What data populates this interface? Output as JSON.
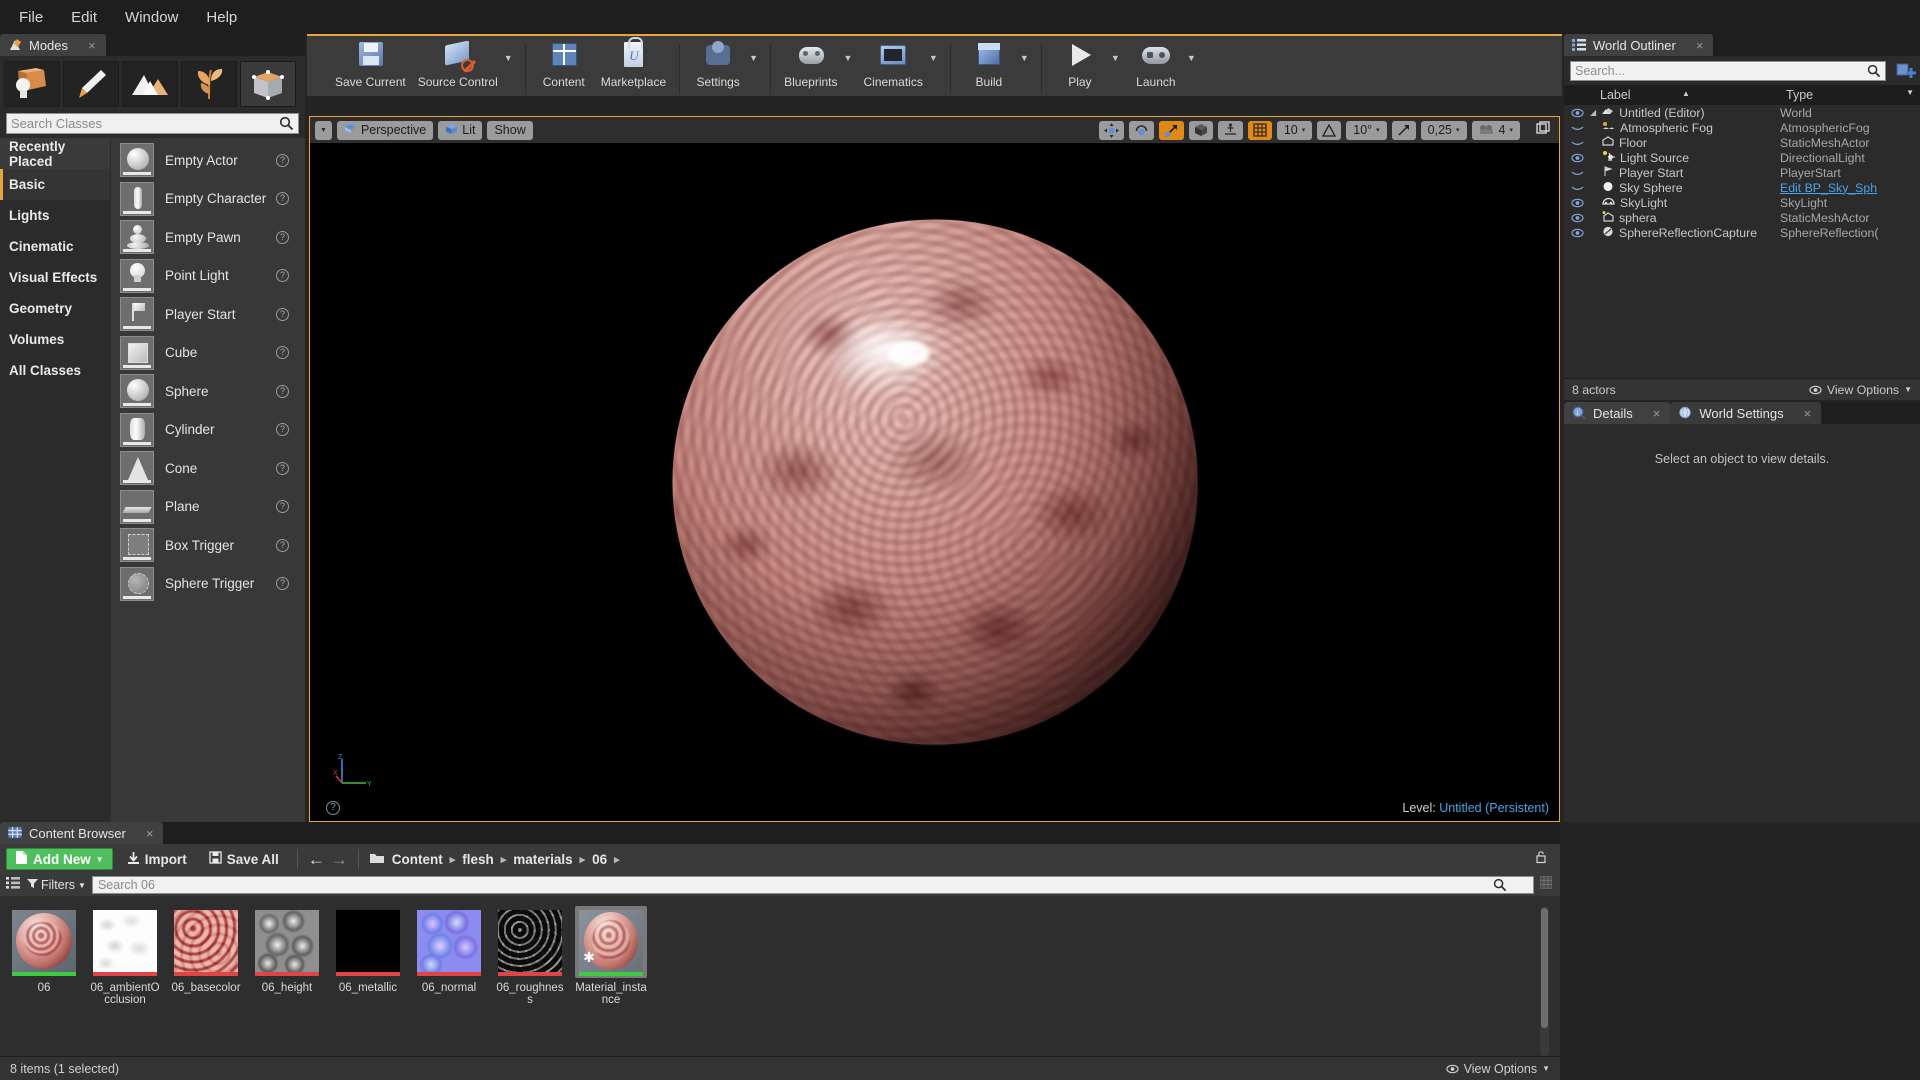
{
  "menu": {
    "items": [
      "File",
      "Edit",
      "Window",
      "Help"
    ]
  },
  "modes": {
    "tab_label": "Modes",
    "tab_icon": "modes-icon",
    "close_icon": "close-icon",
    "mode_buttons": [
      {
        "name": "place-mode",
        "icon": "box-place-icon",
        "selected": false
      },
      {
        "name": "paint-mode",
        "icon": "brush-icon",
        "selected": false
      },
      {
        "name": "landscape-mode",
        "icon": "mountain-icon",
        "selected": false
      },
      {
        "name": "foliage-mode",
        "icon": "leaf-icon",
        "selected": false
      },
      {
        "name": "geometry-edit-mode",
        "icon": "geometry-box-icon",
        "selected": true
      }
    ],
    "search_placeholder": "Search Classes",
    "categories": [
      {
        "label": "Recently Placed",
        "state": "hover"
      },
      {
        "label": "Basic",
        "state": "selected"
      },
      {
        "label": "Lights",
        "state": "normal"
      },
      {
        "label": "Cinematic",
        "state": "normal"
      },
      {
        "label": "Visual Effects",
        "state": "normal"
      },
      {
        "label": "Geometry",
        "state": "normal"
      },
      {
        "label": "Volumes",
        "state": "normal"
      },
      {
        "label": "All Classes",
        "state": "normal"
      }
    ],
    "actors": [
      {
        "label": "Empty Actor",
        "shape": "sphere"
      },
      {
        "label": "Empty Character",
        "shape": "person"
      },
      {
        "label": "Empty Pawn",
        "shape": "pawn"
      },
      {
        "label": "Point Light",
        "shape": "bulb"
      },
      {
        "label": "Player Start",
        "shape": "flag"
      },
      {
        "label": "Cube",
        "shape": "cube"
      },
      {
        "label": "Sphere",
        "shape": "sphere"
      },
      {
        "label": "Cylinder",
        "shape": "cylinder"
      },
      {
        "label": "Cone",
        "shape": "cone"
      },
      {
        "label": "Plane",
        "shape": "plane"
      },
      {
        "label": "Box Trigger",
        "shape": "boxtrigger"
      },
      {
        "label": "Sphere Trigger",
        "shape": "spheretrigger"
      }
    ],
    "help_icon": "question-icon"
  },
  "toolbar": {
    "groups": [
      {
        "items": [
          {
            "label": "Save Current",
            "icon": "floppy-disk-icon",
            "dropdown": false
          },
          {
            "label": "Source Control",
            "icon": "source-control-disabled-icon",
            "dropdown": true
          }
        ]
      },
      {
        "items": [
          {
            "label": "Content",
            "icon": "content-grid-icon",
            "dropdown": false
          },
          {
            "label": "Marketplace",
            "icon": "marketplace-bag-icon",
            "dropdown": false
          }
        ]
      },
      {
        "items": [
          {
            "label": "Settings",
            "icon": "gear-icon",
            "dropdown": true
          }
        ]
      },
      {
        "items": [
          {
            "label": "Blueprints",
            "icon": "blueprint-icon",
            "dropdown": true
          },
          {
            "label": "Cinematics",
            "icon": "clapperboard-icon",
            "dropdown": true
          }
        ]
      },
      {
        "items": [
          {
            "label": "Build",
            "icon": "build-box-icon",
            "dropdown": true
          }
        ]
      },
      {
        "items": [
          {
            "label": "Play",
            "icon": "play-icon",
            "dropdown": true
          },
          {
            "label": "Launch",
            "icon": "gamepad-icon",
            "dropdown": true
          }
        ]
      }
    ]
  },
  "viewport": {
    "menu_arrow_icon": "chevron-down-icon",
    "perspective_label": "Perspective",
    "perspective_icon": "camera-perspective-icon",
    "lit_label": "Lit",
    "lit_icon": "lit-cube-icon",
    "show_label": "Show",
    "transform_tools": [
      {
        "name": "translate-tool",
        "icon": "move-icon",
        "active": false
      },
      {
        "name": "rotate-tool",
        "icon": "rotate-icon",
        "active": false
      },
      {
        "name": "scale-tool",
        "icon": "scale-icon",
        "active": true
      }
    ],
    "coord_system_icon": "world-cube-icon",
    "surface-snap_icon": "surface-snap-icon",
    "grid_snap": {
      "icon": "grid-icon",
      "active": true,
      "value": "10"
    },
    "angle_snap": {
      "icon": "angle-icon",
      "value": "10°"
    },
    "scale_snap": {
      "icon": "scale-snap-icon",
      "value": "0,25"
    },
    "camera_speed": {
      "icon": "camera-speed-icon",
      "value": "4"
    },
    "maximize_icon": "maximize-viewport-icon",
    "help_icon": "question-icon",
    "level_prefix": "Level:",
    "level_name": "Untitled (Persistent)",
    "axis": {
      "x": "X",
      "y": "Y",
      "z": "Z",
      "x_color": "#d03a3a",
      "y_color": "#3ec13e",
      "z_color": "#4a7fe0"
    }
  },
  "outliner": {
    "tab_label": "World Outliner",
    "tab_icon": "outliner-list-icon",
    "close_icon": "close-icon",
    "search_placeholder": "Search...",
    "search_icon": "search-icon",
    "add_icon": "add-item-icon",
    "columns": {
      "label": "Label",
      "type": "Type"
    },
    "sort_icon": "sort-asc-icon",
    "rows": [
      {
        "label": "Untitled (Editor)",
        "type": "World",
        "indent": 0,
        "eye": "visible",
        "icon": "world-icon",
        "expander": true,
        "link": false
      },
      {
        "label": "Atmospheric Fog",
        "type": "AtmosphericFog",
        "indent": 1,
        "eye": "hidden",
        "icon": "fog-icon",
        "expander": false,
        "link": false
      },
      {
        "label": "Floor",
        "type": "StaticMeshActor",
        "indent": 1,
        "eye": "hidden",
        "icon": "mesh-icon",
        "expander": false,
        "link": false
      },
      {
        "label": "Light Source",
        "type": "DirectionalLight",
        "indent": 1,
        "eye": "visible",
        "icon": "light-icon",
        "expander": false,
        "link": false
      },
      {
        "label": "Player Start",
        "type": "PlayerStart",
        "indent": 1,
        "eye": "hidden",
        "icon": "playerstart-icon",
        "expander": false,
        "link": false
      },
      {
        "label": "Sky Sphere",
        "type": "Edit BP_Sky_Sph",
        "indent": 1,
        "eye": "hidden",
        "icon": "sphere-icon",
        "expander": false,
        "link": true
      },
      {
        "label": "SkyLight",
        "type": "SkyLight",
        "indent": 1,
        "eye": "visible",
        "icon": "skylight-icon",
        "expander": false,
        "link": false
      },
      {
        "label": "sphera",
        "type": "StaticMeshActor",
        "indent": 1,
        "eye": "visible",
        "icon": "mesh-icon",
        "expander": false,
        "link": false
      },
      {
        "label": "SphereReflectionCapture",
        "type": "SphereReflection(",
        "indent": 1,
        "eye": "visible",
        "icon": "reflection-icon",
        "expander": false,
        "link": false
      }
    ],
    "footer_count": "8 actors",
    "view_options_label": "View Options",
    "view_options_icon": "eye-icon",
    "view_options_caret": "caret-down-icon"
  },
  "details": {
    "tabs": [
      {
        "label": "Details",
        "icon": "details-info-icon",
        "active": true,
        "close_icon": "close-icon"
      },
      {
        "label": "World Settings",
        "icon": "world-settings-icon",
        "active": false,
        "close_icon": "close-icon"
      }
    ],
    "empty_message": "Select an object to view details."
  },
  "content_browser": {
    "tab_label": "Content Browser",
    "tab_icon": "content-browser-icon",
    "close_icon": "close-icon",
    "add_new_label": "Add New",
    "add_new_icon": "new-asset-icon",
    "add_new_caret": "caret-down-icon",
    "import_label": "Import",
    "import_icon": "import-icon",
    "save_all_label": "Save All",
    "save_all_icon": "save-icon",
    "back_icon": "arrow-left-icon",
    "forward_icon": "arrow-right-icon",
    "folder_icon": "folder-icon",
    "breadcrumb": [
      "Content",
      "flesh",
      "materials",
      "06"
    ],
    "breadcrumb_sep": "▸",
    "lock_icon": "lock-icon",
    "sources_icon": "sources-panel-icon",
    "filters_label": "Filters",
    "filters_icon": "filter-icon",
    "filters_caret": "caret-down-icon",
    "search_placeholder": "Search 06",
    "search_icon": "search-icon",
    "view_toggle_icon": "view-options-icon",
    "assets": [
      {
        "name": "06",
        "kind": "flesh-sphere-render",
        "bar_color": "#3fcb3f",
        "selected": false,
        "modified": false
      },
      {
        "name": "06_ambientOcclusion",
        "kind": "ao-texture",
        "bar_color": "#e04545",
        "selected": false,
        "modified": false
      },
      {
        "name": "06_basecolor",
        "kind": "basecolor-texture",
        "bar_color": "#e04545",
        "selected": false,
        "modified": false
      },
      {
        "name": "06_height",
        "kind": "height-texture",
        "bar_color": "#e04545",
        "selected": false,
        "modified": false
      },
      {
        "name": "06_metallic",
        "kind": "metallic-texture",
        "bar_color": "#e04545",
        "selected": false,
        "modified": false
      },
      {
        "name": "06_normal",
        "kind": "normal-texture",
        "bar_color": "#e04545",
        "selected": false,
        "modified": false
      },
      {
        "name": "06_roughness",
        "kind": "roughness-texture",
        "bar_color": "#e04545",
        "selected": false,
        "modified": false
      },
      {
        "name": "Material_instance",
        "kind": "material-instance",
        "bar_color": "#3fcb3f",
        "selected": true,
        "modified": true
      }
    ],
    "footer_status": "8 items (1 selected)",
    "view_options_label": "View Options",
    "view_options_icon": "eye-icon",
    "view_options_caret": "caret-down-icon"
  }
}
